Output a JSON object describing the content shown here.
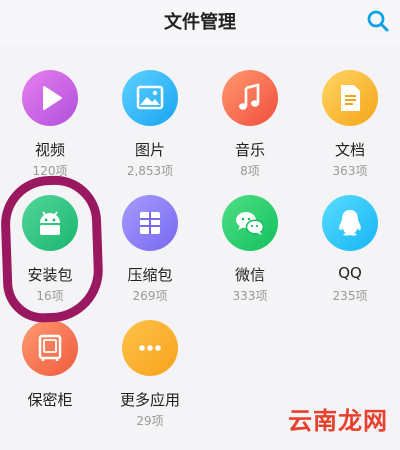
{
  "header": {
    "title": "文件管理"
  },
  "items": [
    {
      "label": "视频",
      "count": "120项",
      "icon": "play-icon",
      "colors": [
        "#e77ff0",
        "#b04fdc"
      ]
    },
    {
      "label": "图片",
      "count": "2,853项",
      "icon": "image-icon",
      "colors": [
        "#5fd1ff",
        "#18a4f2"
      ]
    },
    {
      "label": "音乐",
      "count": "8项",
      "icon": "music-note-icon",
      "colors": [
        "#ff9a70",
        "#f24c3e"
      ]
    },
    {
      "label": "文档",
      "count": "363项",
      "icon": "document-icon",
      "colors": [
        "#ffd564",
        "#f5a418"
      ]
    },
    {
      "label": "安装包",
      "count": "16项",
      "icon": "android-icon",
      "colors": [
        "#54d69a",
        "#19b66f"
      ]
    },
    {
      "label": "压缩包",
      "count": "269项",
      "icon": "archive-icon",
      "colors": [
        "#a79bff",
        "#7869ef"
      ]
    },
    {
      "label": "微信",
      "count": "333项",
      "icon": "wechat-icon",
      "colors": [
        "#4fdf84",
        "#13c05e"
      ]
    },
    {
      "label": "QQ",
      "count": "235项",
      "icon": "qq-penguin-icon",
      "colors": [
        "#59dcff",
        "#15b5f4"
      ]
    },
    {
      "label": "保密柜",
      "count": "",
      "icon": "safe-icon",
      "colors": [
        "#ff9a72",
        "#ef5a3c"
      ]
    },
    {
      "label": "更多应用",
      "count": "29项",
      "icon": "more-icon",
      "colors": [
        "#ffc24b",
        "#f7a21a"
      ]
    }
  ],
  "watermark": "云南龙网",
  "annotation_color": "#9a1860"
}
